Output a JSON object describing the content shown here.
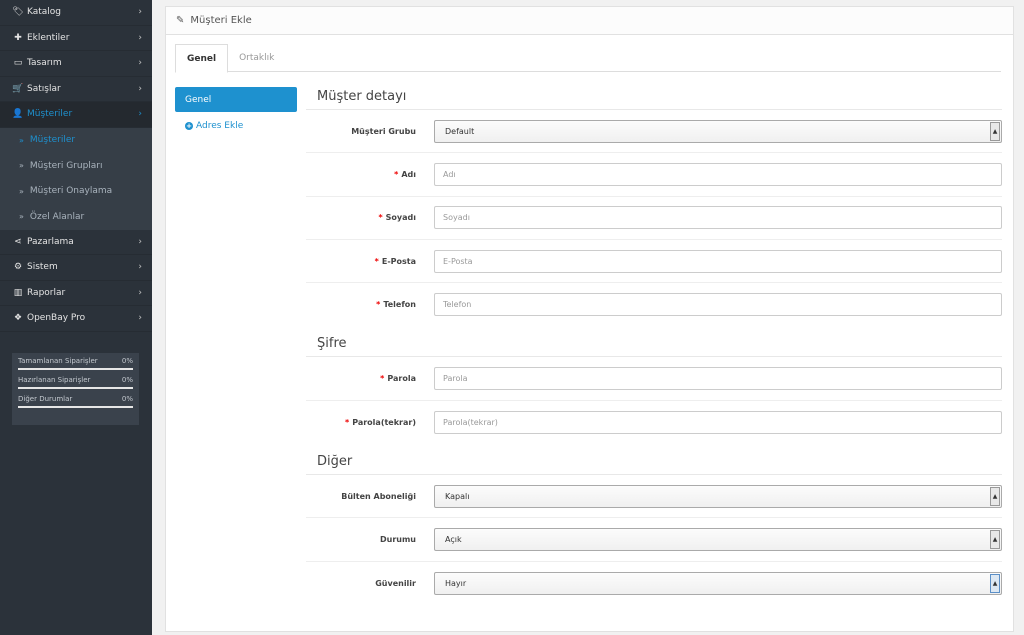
{
  "sidebar": {
    "menu_top": [
      {
        "label": "Katalog",
        "icon": "tag-icon",
        "glyph": "🏷"
      },
      {
        "label": "Eklentiler",
        "icon": "puzzle-icon",
        "glyph": "✚"
      },
      {
        "label": "Tasarım",
        "icon": "monitor-icon",
        "glyph": "▭"
      },
      {
        "label": "Satışlar",
        "icon": "cart-icon",
        "glyph": "🛒"
      },
      {
        "label": "Müşteriler",
        "icon": "user-icon",
        "glyph": "👤"
      }
    ],
    "submenu": [
      {
        "label": "Müşteriler"
      },
      {
        "label": "Müşteri Grupları"
      },
      {
        "label": "Müşteri Onaylama"
      },
      {
        "label": "Özel Alanlar"
      }
    ],
    "menu_bottom": [
      {
        "label": "Pazarlama",
        "icon": "share-icon",
        "glyph": "⋖"
      },
      {
        "label": "Sistem",
        "icon": "gear-icon",
        "glyph": "⚙"
      },
      {
        "label": "Raporlar",
        "icon": "bar-chart-icon",
        "glyph": "▥"
      },
      {
        "label": "OpenBay Pro",
        "icon": "cubes-icon",
        "glyph": "❖"
      }
    ],
    "status": [
      {
        "label": "Tamamlanan Siparişler",
        "value": "0%"
      },
      {
        "label": "Hazırlanan Siparişler",
        "value": "0%"
      },
      {
        "label": "Diğer Durumlar",
        "value": "0%"
      }
    ]
  },
  "panel": {
    "title": "Müşteri Ekle",
    "tabs": [
      {
        "label": "Genel"
      },
      {
        "label": "Ortaklık"
      }
    ],
    "left_nav": {
      "active": "Genel",
      "add_address": "Adres Ekle"
    }
  },
  "form": {
    "section_detail": "Müşter detayı",
    "group_label": "Müşteri Grubu",
    "group_value": "Default",
    "firstname_label": "Adı",
    "firstname_ph": "Adı",
    "lastname_label": "Soyadı",
    "lastname_ph": "Soyadı",
    "email_label": "E-Posta",
    "email_ph": "E-Posta",
    "phone_label": "Telefon",
    "phone_ph": "Telefon",
    "section_password": "Şifre",
    "password_label": "Parola",
    "password_ph": "Parola",
    "confirm_label": "Parola(tekrar)",
    "confirm_ph": "Parola(tekrar)",
    "section_other": "Diğer",
    "newsletter_label": "Bülten Aboneliği",
    "newsletter_value": "Kapalı",
    "status_label": "Durumu",
    "status_value": "Açık",
    "safe_label": "Güvenilir",
    "safe_value": "Hayır"
  }
}
